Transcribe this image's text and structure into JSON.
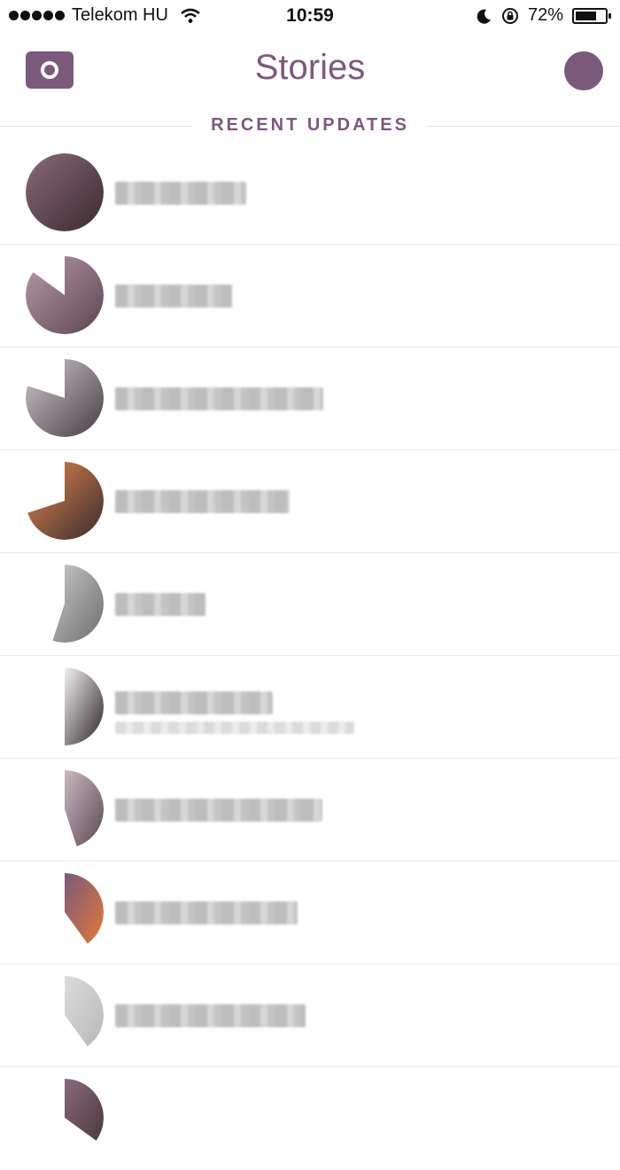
{
  "status_bar": {
    "carrier": "Telekom HU",
    "time": "10:59",
    "battery": "72%",
    "battery_level": 0.72,
    "icons": [
      "signal-dots-icon",
      "wifi-icon",
      "moon-icon",
      "rotation-lock-icon",
      "battery-icon"
    ]
  },
  "header": {
    "title": "Stories",
    "left_button_icon": "camera-icon",
    "right_button_icon": "profile-icon"
  },
  "section": {
    "label": "RECENT UPDATES"
  },
  "stories": [
    {
      "name": "",
      "has_subtitle": false,
      "story_progress": 1.0
    },
    {
      "name": "",
      "has_subtitle": false,
      "story_progress": 0.85
    },
    {
      "name": "",
      "has_subtitle": false,
      "story_progress": 0.8
    },
    {
      "name": "",
      "has_subtitle": false,
      "story_progress": 0.7
    },
    {
      "name": "",
      "has_subtitle": false,
      "story_progress": 0.55
    },
    {
      "name": "",
      "has_subtitle": true,
      "story_progress": 0.5
    },
    {
      "name": "",
      "has_subtitle": false,
      "story_progress": 0.45
    },
    {
      "name": "",
      "has_subtitle": false,
      "story_progress": 0.4
    },
    {
      "name": "",
      "has_subtitle": false,
      "story_progress": 0.4
    },
    {
      "name": "",
      "has_subtitle": false,
      "story_progress": 0.35
    }
  ],
  "colors": {
    "accent": "#7b5a7b",
    "separator": "#ececec",
    "blur": "#c8c8c8"
  }
}
